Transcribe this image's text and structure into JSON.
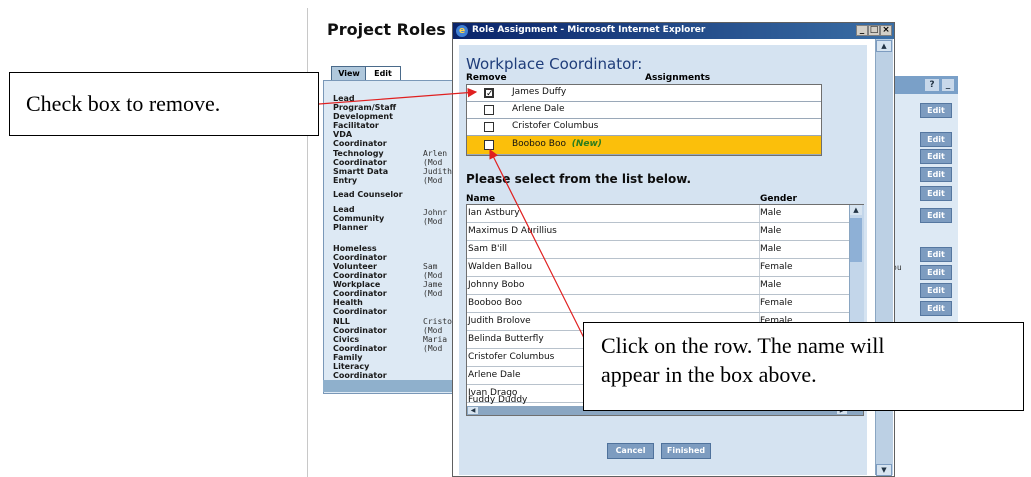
{
  "background_page": {
    "title": "Project Roles",
    "tabs": [
      "View",
      "Edit"
    ],
    "roles": [
      {
        "label": "Lead\nProgram/Staff\nDevelopment\nFacilitator",
        "assign": ""
      },
      {
        "label": "VDA\nCoordinator",
        "assign": ""
      },
      {
        "label": "Technology\nCoordinator",
        "assign": "Arlen\n(Mod"
      },
      {
        "label": "Smartt Data\nEntry",
        "assign": "Judith\n(Mod"
      },
      {
        "label": "Lead Counselor",
        "assign": ""
      },
      {
        "label": "Lead\nCommunity\nPlanner",
        "assign": "Johnr\n(Mod"
      },
      {
        "label": "Homeless\nCoordinator",
        "assign": ""
      },
      {
        "label": "Volunteer\nCoordinator",
        "assign": "Sam\n(Mod"
      },
      {
        "label": "Workplace\nCoordinator",
        "assign": "Jame\n(Mod"
      },
      {
        "label": "Health\nCoordinator",
        "assign": ""
      },
      {
        "label": "NLL\nCoordinator",
        "assign": "Cristo\n(Mod"
      },
      {
        "label": "Civics\nCoordinator",
        "assign": "Maria\n(Mod"
      },
      {
        "label": "Family\nLiteracy\nCoordinator",
        "assign": ""
      }
    ],
    "edit_label": "Edit",
    "help_label": "?",
    "min_label": "_",
    "right_partial": "ou"
  },
  "dialog": {
    "window_title": "Role Assignment - Microsoft Internet Explorer",
    "heading": "Workplace Coordinator:",
    "col_remove": "Remove",
    "col_assignments": "Assignments",
    "assignments": [
      {
        "name": "James Duffy",
        "checked": true,
        "new": false
      },
      {
        "name": "Arlene Dale",
        "checked": false,
        "new": false
      },
      {
        "name": "Cristofer Columbus",
        "checked": false,
        "new": false
      },
      {
        "name": "Booboo Boo",
        "checked": false,
        "new": true
      }
    ],
    "new_tag": "(New)",
    "select_prompt": "Please select from the list below.",
    "col_name": "Name",
    "col_gender": "Gender",
    "people": [
      {
        "name": "Ian Astbury",
        "gender": "Male"
      },
      {
        "name": "Maximus D Aurillius",
        "gender": "Male"
      },
      {
        "name": "Sam B'ill",
        "gender": "Male"
      },
      {
        "name": "Walden Ballou",
        "gender": "Female"
      },
      {
        "name": "Johnny Bobo",
        "gender": "Male"
      },
      {
        "name": "Booboo Boo",
        "gender": "Female"
      },
      {
        "name": "Judith Brolove",
        "gender": "Female"
      },
      {
        "name": "Belinda Butterfly",
        "gender": ""
      },
      {
        "name": "Cristofer Columbus",
        "gender": ""
      },
      {
        "name": "Arlene Dale",
        "gender": ""
      },
      {
        "name": "Ivan Drago",
        "gender": ""
      },
      {
        "name": "Fuddy Duddy",
        "gender": ""
      }
    ],
    "cancel_label": "Cancel",
    "finished_label": "Finished"
  },
  "callouts": {
    "remove": "Check box to remove.",
    "row_line1": "Click on the row. The name will",
    "row_line2": "appear in the box above."
  },
  "colors": {
    "title_bar": "#0a246a",
    "new_row_highlight": "#fbbf0b",
    "new_tag": "#2d7d1e",
    "button": "#7d9cc0",
    "arrow": "#e02020"
  }
}
